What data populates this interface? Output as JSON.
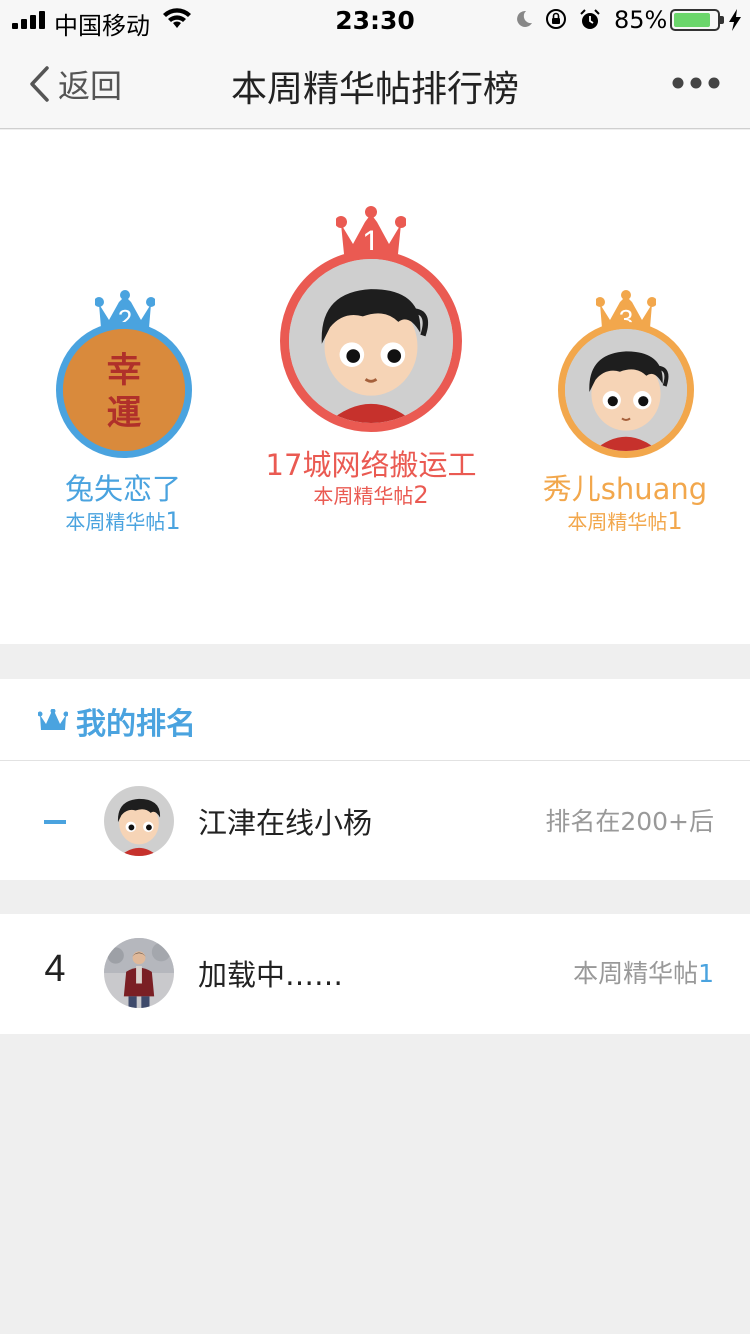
{
  "status": {
    "carrier": "中国移动",
    "time": "23:30",
    "battery_pct": "85%",
    "battery_level": 0.85
  },
  "nav": {
    "back_label": "返回",
    "title": "本周精华帖排行榜"
  },
  "podium": {
    "first": {
      "rank": "1",
      "name": "17城网络搬运工",
      "posts_label": "本周精华帖",
      "posts": "2",
      "color": "#ea5a52"
    },
    "second": {
      "rank": "2",
      "name": "兔失恋了",
      "posts_label": "本周精华帖",
      "posts": "1",
      "color": "#4aa3df"
    },
    "third": {
      "rank": "3",
      "name": "秀儿shuang",
      "posts_label": "本周精华帖",
      "posts": "1",
      "color": "#f2a74c"
    }
  },
  "my_rank": {
    "header": "我的排名",
    "name": "江津在线小杨",
    "status": "排名在200+后"
  },
  "list": [
    {
      "rank": "4",
      "name": "加载中……",
      "posts_label": "本周精华帖",
      "posts": "1"
    }
  ],
  "colors": {
    "accent": "#4aa3df",
    "first": "#ea5a52",
    "second": "#4aa3df",
    "third": "#f2a74c"
  }
}
